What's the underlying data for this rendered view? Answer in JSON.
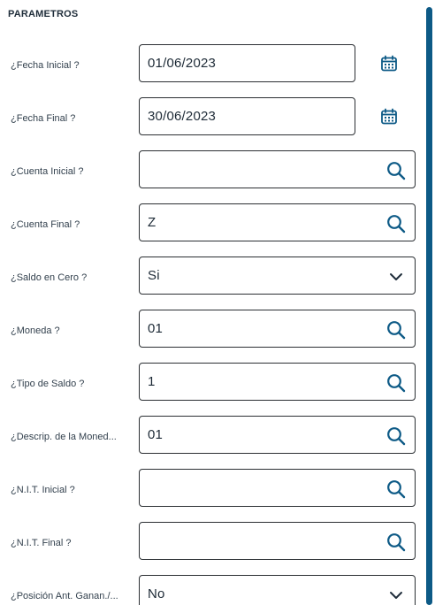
{
  "section_title": "PARAMETROS",
  "colors": {
    "accent": "#0d5a86",
    "border": "#2b2f33"
  },
  "fields": [
    {
      "label": "¿Fecha Inicial ?",
      "value": "01/06/2023",
      "kind": "date",
      "icon": "calendar-icon"
    },
    {
      "label": "¿Fecha Final ?",
      "value": "30/06/2023",
      "kind": "date",
      "icon": "calendar-icon"
    },
    {
      "label": "¿Cuenta Inicial ?",
      "value": "",
      "kind": "lookup",
      "icon": "search-icon"
    },
    {
      "label": "¿Cuenta Final ?",
      "value": "Z",
      "kind": "lookup",
      "icon": "search-icon"
    },
    {
      "label": "¿Saldo en Cero ?",
      "value": "Si",
      "kind": "select",
      "icon": "chevron-down-icon"
    },
    {
      "label": "¿Moneda ?",
      "value": "01",
      "kind": "lookup",
      "icon": "search-icon"
    },
    {
      "label": "¿Tipo de Saldo ?",
      "value": "1",
      "kind": "lookup",
      "icon": "search-icon"
    },
    {
      "label": "¿Descrip. de la Moned...",
      "value": "01",
      "kind": "lookup",
      "icon": "search-icon"
    },
    {
      "label": "¿N.I.T. Inicial ?",
      "value": "",
      "kind": "lookup",
      "icon": "search-icon"
    },
    {
      "label": "¿N.I.T. Final ?",
      "value": "",
      "kind": "lookup",
      "icon": "search-icon"
    },
    {
      "label": "¿Posición Ant. Ganan./...",
      "value": "No",
      "kind": "select",
      "icon": "chevron-down-icon"
    }
  ]
}
